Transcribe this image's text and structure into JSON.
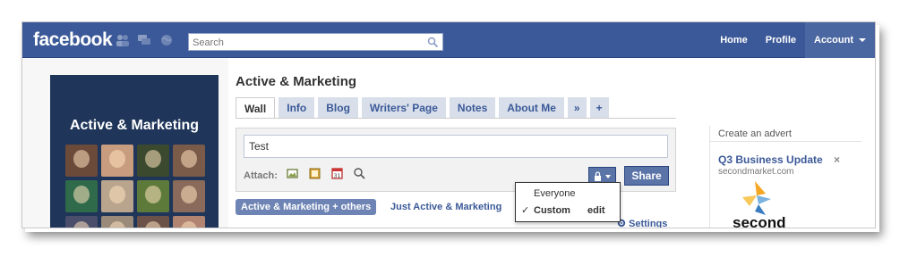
{
  "topbar": {
    "logo": "facebook",
    "search_placeholder": "Search",
    "nav": {
      "home": "Home",
      "profile": "Profile",
      "account": "Account"
    }
  },
  "profile": {
    "name": "Active & Marketing",
    "photo_colors": [
      "#6b4a3a",
      "#c89c7e",
      "#3b4a2e",
      "#7a5a48",
      "#2f6a4a",
      "#b9a48e",
      "#5e7a3a",
      "#8a6a5a",
      "#4a4e6a",
      "#9a8a7a",
      "#6a5248",
      "#b08470"
    ]
  },
  "page": {
    "title": "Active & Marketing",
    "tabs": [
      {
        "label": "Wall",
        "active": true
      },
      {
        "label": "Info"
      },
      {
        "label": "Blog"
      },
      {
        "label": "Writers' Page"
      },
      {
        "label": "Notes"
      },
      {
        "label": "About Me"
      },
      {
        "label": "»"
      },
      {
        "label": "+"
      }
    ]
  },
  "composer": {
    "status_text": "Test",
    "attach_label": "Attach:",
    "attach_icons": [
      "photo-icon",
      "video-icon",
      "event-icon",
      "link-icon"
    ],
    "share_label": "Share"
  },
  "privacy_menu": {
    "items": [
      {
        "label": "Everyone",
        "checked": false
      },
      {
        "label": "Custom",
        "checked": true,
        "check": "✓",
        "action": "edit"
      }
    ]
  },
  "filters": {
    "active": "Active & Marketing + others",
    "other": "Just Active & Marketing",
    "settings": "Settings"
  },
  "sidebar_ad": {
    "create_advert": "Create an advert",
    "title": "Q3 Business Update",
    "domain": "secondmarket.com",
    "close": "×",
    "image_text": "second"
  },
  "colors": {
    "brand_blue": "#3b5998",
    "button_blue": "#5b74a8",
    "profile_box": "#1f3559",
    "tab_bg": "#d8dfea"
  }
}
